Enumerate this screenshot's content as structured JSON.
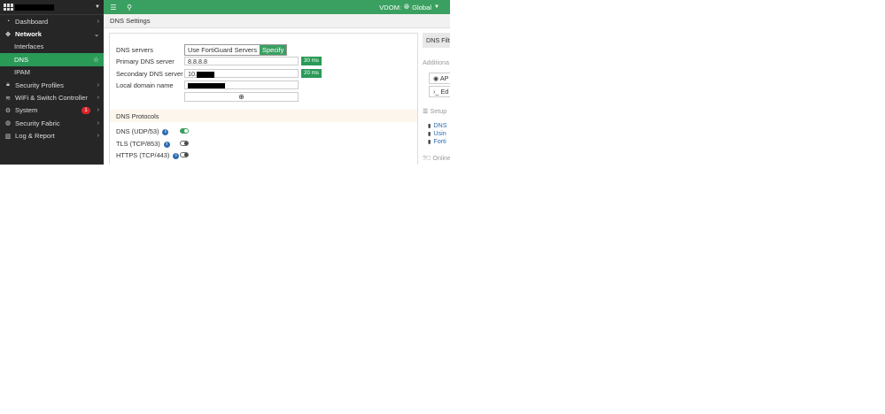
{
  "sidebar": {
    "items": [
      {
        "label": "Dashboard",
        "icon": "dashboard-icon"
      },
      {
        "label": "Network",
        "icon": "network-icon"
      },
      {
        "label": "Interfaces"
      },
      {
        "label": "DNS"
      },
      {
        "label": "IPAM"
      },
      {
        "label": "Security Profiles",
        "icon": "lock-icon"
      },
      {
        "label": "WiFi & Switch Controller",
        "icon": "wifi-icon"
      },
      {
        "label": "System",
        "icon": "gear-icon",
        "badge": "1"
      },
      {
        "label": "Security Fabric",
        "icon": "fabric-icon"
      },
      {
        "label": "Log & Report",
        "icon": "chart-icon"
      }
    ]
  },
  "topbar": {
    "vdom_label": "VDOM:",
    "vdom_value": "Global"
  },
  "breadcrumb": "DNS Settings",
  "form": {
    "dns_servers_label": "DNS servers",
    "option_fortiguard": "Use FortiGuard Servers",
    "option_specify": "Specify",
    "primary_label": "Primary DNS server",
    "primary_value": "8.8.8.8",
    "primary_latency": "30 ms",
    "secondary_label": "Secondary DNS server",
    "secondary_value_prefix": "10.",
    "secondary_latency": "20 ms",
    "local_domain_label": "Local domain name"
  },
  "protocols": {
    "title": "DNS Protocols",
    "items": [
      {
        "label": "DNS (UDP/53)",
        "enabled": true
      },
      {
        "label": "TLS (TCP/853)",
        "enabled": false
      },
      {
        "label": "HTTPS (TCP/443)",
        "enabled": false
      }
    ]
  },
  "side_panel": {
    "tab": "DNS Filte",
    "additional": "Additiona",
    "btn_api": "AP",
    "btn_edit": "Ed",
    "setup": "Setup",
    "links": [
      "DNS",
      "Usin",
      "Forti"
    ],
    "online": "Online"
  },
  "colors": {
    "accent": "#3aa061",
    "active_nav": "#2a9a57",
    "sidebar_bg": "#262626",
    "badge": "#d9252a"
  }
}
